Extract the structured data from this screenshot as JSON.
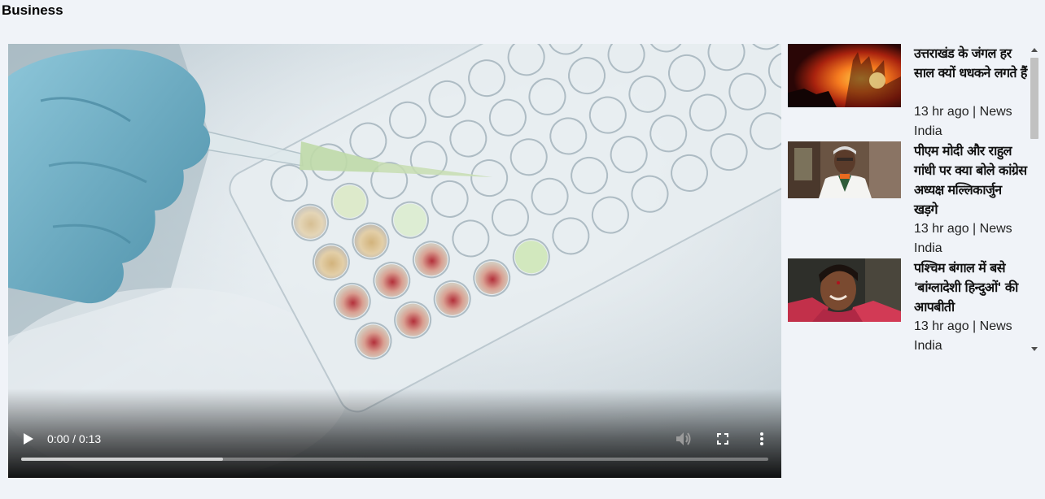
{
  "section": {
    "title": "Business"
  },
  "video": {
    "time_display": "0:00 / 0:13",
    "buffered_fraction": 0.27,
    "controls": {
      "play_icon": "play-icon",
      "mute_icon": "volume-icon",
      "fullscreen_icon": "fullscreen-icon",
      "more_icon": "more-vertical-icon"
    }
  },
  "sidebar": {
    "items": [
      {
        "headline": "उत्तराखंड के जंगल हर साल क्यों धधकने लगते हैं",
        "meta": "13 hr ago | News India"
      },
      {
        "headline": "पीएम मोदी और राहुल गांधी पर क्या बोले कांग्रेस अध्यक्ष मल्लिकार्जुन खड़गे",
        "meta": "13 hr ago | News India"
      },
      {
        "headline": "पश्चिम बंगाल में बसे 'बांग्लादेशी हिन्दुओं' की आपबीती",
        "meta": "13 hr ago | News India"
      }
    ]
  },
  "colors": {
    "page_background": "#f0f3f8",
    "scroll_thumb": "#c1c1c1"
  }
}
